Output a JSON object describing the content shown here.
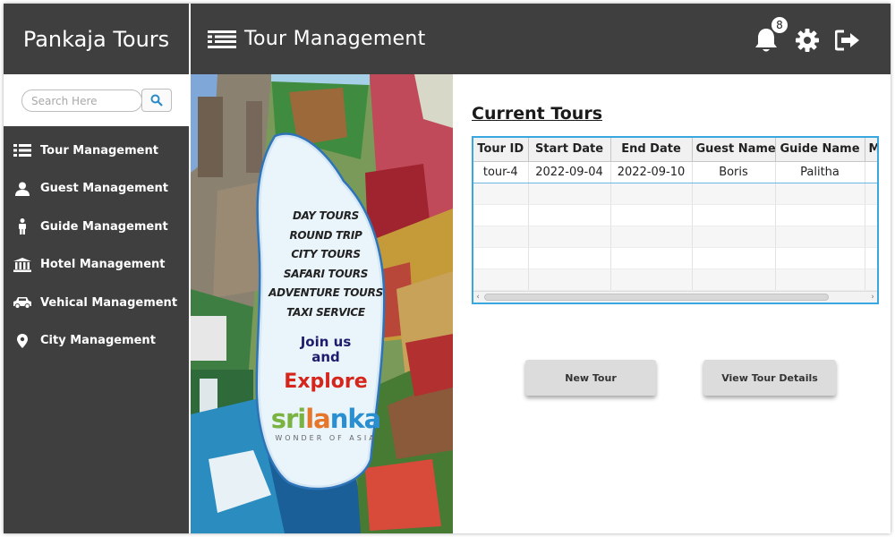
{
  "app": {
    "brand": "Pankaja Tours"
  },
  "header": {
    "title": "Tour Management",
    "notification_count": "8",
    "icons": [
      "list-icon",
      "bell-icon",
      "gear-icon",
      "logout-icon"
    ]
  },
  "search": {
    "placeholder": "Search Here",
    "icon": "search-icon"
  },
  "sidebar": {
    "items": [
      {
        "label": "Tour Management",
        "icon": "list-icon"
      },
      {
        "label": "Guest Management",
        "icon": "user-icon"
      },
      {
        "label": "Guide Management",
        "icon": "person-icon"
      },
      {
        "label": "Hotel Management",
        "icon": "bank-icon"
      },
      {
        "label": "Vehical Management",
        "icon": "car-icon"
      },
      {
        "label": "City Management",
        "icon": "map-marker-icon"
      }
    ]
  },
  "banner": {
    "lines": [
      "DAY TOURS",
      "ROUND TRIP",
      "CITY TOURS",
      "SAFARI TOURS",
      "ADVENTURE TOURS",
      "TAXI SERVICE"
    ],
    "join": "Join us",
    "and": "and",
    "explore": "Explore",
    "brand": "srilanka",
    "tagline": "WONDER OF ASIA"
  },
  "main": {
    "section_title": "Current Tours",
    "table": {
      "columns": [
        "Tour ID",
        "Start Date",
        "End Date",
        "Guest Name",
        "Guide Name",
        "M"
      ],
      "rows": [
        [
          "tour-4",
          "2022-09-04",
          "2022-09-10",
          "Boris",
          "Palitha",
          ""
        ]
      ]
    },
    "buttons": {
      "new_tour": "New Tour",
      "view_details": "View Tour Details"
    }
  },
  "colors": {
    "dark": "#3f3f3f",
    "accent": "#39a8e0",
    "button_bg": "#dcdcdc",
    "explore_red": "#d6261c"
  }
}
